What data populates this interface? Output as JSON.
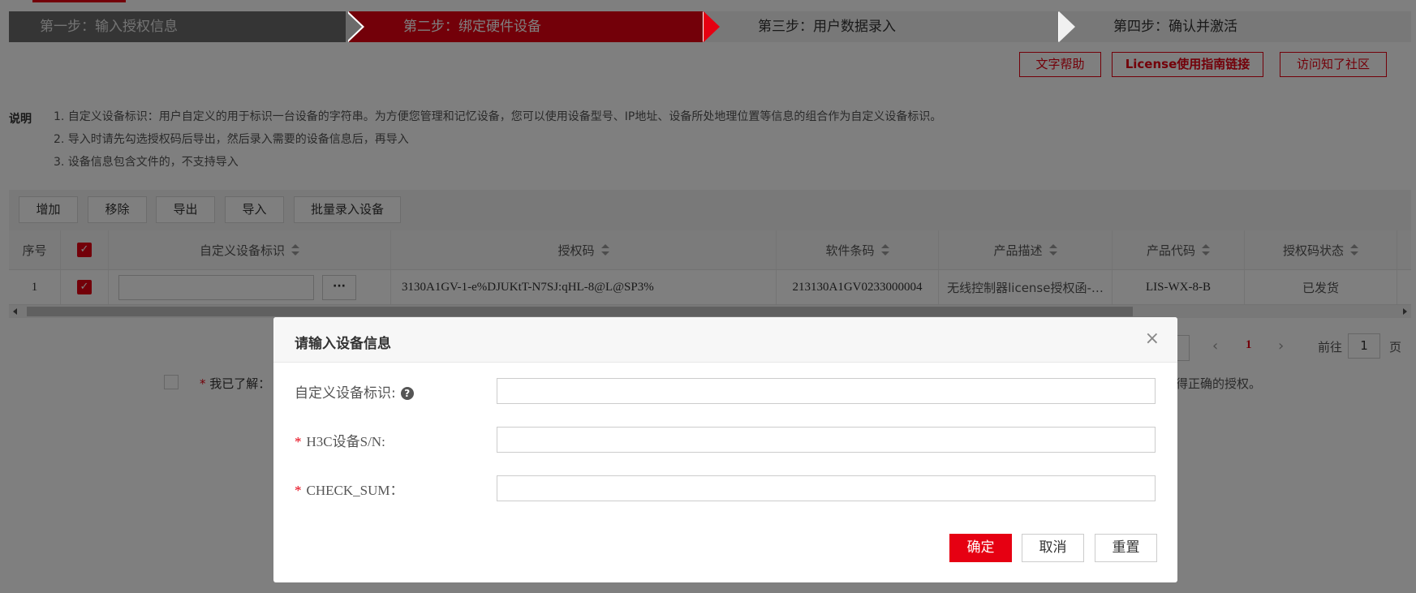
{
  "steps": [
    {
      "label": "第一步：输入授权信息"
    },
    {
      "label": "第二步：绑定硬件设备"
    },
    {
      "label": "第三步：用户数据录入"
    },
    {
      "label": "第四步：确认并激活"
    }
  ],
  "help_links": {
    "text_help": "文字帮助",
    "license_guide": "License使用指南链接",
    "community": "访问知了社区"
  },
  "notes": {
    "label": "说明",
    "items": [
      "1. 自定义设备标识：用户自定义的用于标识一台设备的字符串。为方便您管理和记忆设备，您可以使用设备型号、IP地址、设备所处地理位置等信息的组合作为自定义设备标识。",
      "2. 导入时请先勾选授权码后导出，然后录入需要的设备信息后，再导入",
      "3. 设备信息包含文件的，不支持导入"
    ]
  },
  "toolbar": {
    "add": "增加",
    "remove": "移除",
    "export": "导出",
    "import": "导入",
    "batch": "批量录入设备"
  },
  "table": {
    "headers": {
      "index": "序号",
      "custom_id": "自定义设备标识",
      "auth_code": "授权码",
      "software_code": "软件条码",
      "product_desc": "产品描述",
      "product_code": "产品代码",
      "auth_status": "授权码状态"
    },
    "rows": [
      {
        "index": "1",
        "more": "···",
        "auth_code": "3130A1GV-1-e%DJUKtT-N7SJ:qHL-8@L@SP3%",
        "software_code": "213130A1GV0233000004",
        "product_desc": "无线控制器license授权函-…",
        "product_code": "LIS-WX-8-B",
        "auth_status": "已发货"
      }
    ]
  },
  "pager": {
    "prev": "‹",
    "current": "1",
    "next": "›",
    "goto_label": "前往",
    "goto_value": "1",
    "page_label": "页"
  },
  "agreement": {
    "star": "*",
    "text": "我已了解：",
    "tail": "得正确的授权。"
  },
  "modal": {
    "title": "请输入设备信息",
    "close": "×",
    "fields": {
      "custom_id_label": "自定义设备标识:",
      "sn_label": "H3C设备S/N:",
      "checksum_label": "CHECK_SUM："
    },
    "required_mark": "*",
    "help_icon": "?",
    "buttons": {
      "ok": "确定",
      "cancel": "取消",
      "reset": "重置"
    }
  },
  "colors": {
    "accent": "#e60012",
    "step_done": "#6b6b6b",
    "step_todo": "#f0f0f0"
  }
}
